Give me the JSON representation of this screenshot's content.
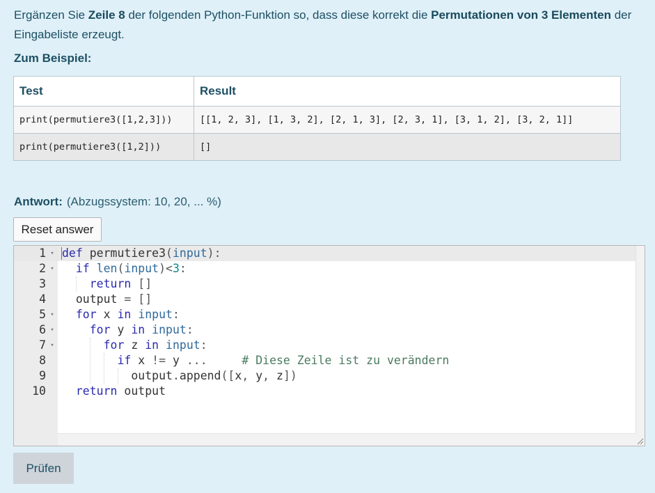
{
  "question": {
    "t1": "Ergänzen Sie ",
    "b1": "Zeile 8",
    "t2": " der folgenden Python-Funktion so, dass diese korrekt die ",
    "b2": "Permutationen von 3 Elementen",
    "t3": " der Eingabeliste erzeugt."
  },
  "example_heading": "Zum Beispiel:",
  "table": {
    "headers": [
      "Test",
      "Result"
    ],
    "rows": [
      [
        "print(permutiere3([1,2,3]))",
        "[[1, 2, 3], [1, 3, 2], [2, 1, 3], [2, 3, 1], [3, 1, 2], [3, 2, 1]]"
      ],
      [
        "print(permutiere3([1,2]))",
        "[]"
      ]
    ]
  },
  "answer": {
    "label": "Antwort:",
    "penalty": "(Abzugssystem: 10, 20, ... %)",
    "reset_label": "Reset answer"
  },
  "editor": {
    "fold_glyph": "▾",
    "line_numbers": [
      "1",
      "2",
      "3",
      "4",
      "5",
      "6",
      "7",
      "8",
      "9",
      "10"
    ],
    "lines": [
      "def permutiere3(input):",
      "  if len(input)<3:",
      "    return []",
      "  output = []",
      "  for x in input:",
      "    for y in input:",
      "      for z in input:",
      "        if x != y ...     # Diese Zeile ist zu verändern",
      "          output.append([x, y, z])",
      "  return output"
    ]
  },
  "check_label": "Prüfen"
}
